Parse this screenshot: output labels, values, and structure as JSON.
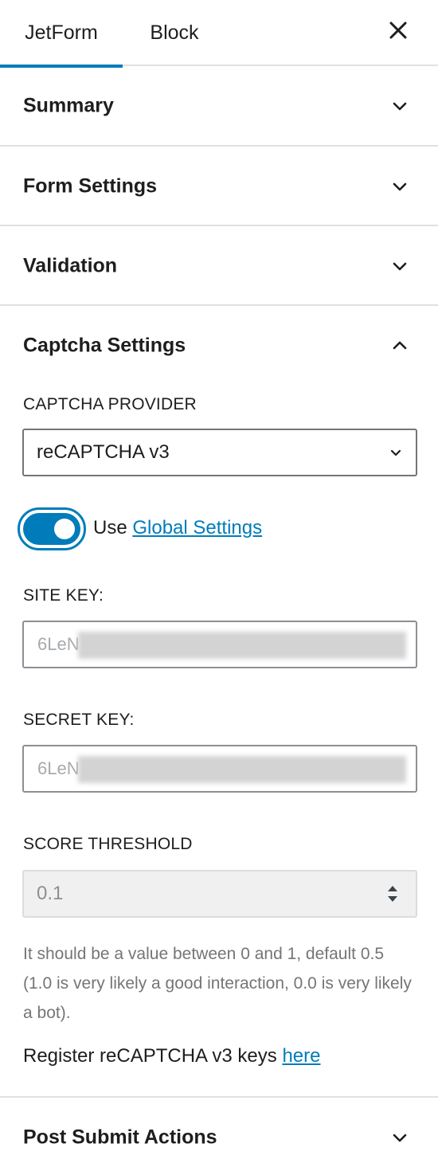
{
  "tabs": [
    {
      "label": "JetForm",
      "active": true
    },
    {
      "label": "Block",
      "active": false
    }
  ],
  "close_icon": "close-icon",
  "panels": {
    "summary": {
      "title": "Summary",
      "expanded": false
    },
    "form_settings": {
      "title": "Form Settings",
      "expanded": false
    },
    "validation": {
      "title": "Validation",
      "expanded": false
    },
    "captcha": {
      "title": "Captcha Settings",
      "expanded": true,
      "provider_label": "CAPTCHA PROVIDER",
      "provider_value": "reCAPTCHA v3",
      "use_global": true,
      "use_text": "Use",
      "use_link": "Global Settings",
      "site_key_label": "SITE KEY:",
      "site_key_value": "6LeN",
      "secret_key_label": "SECRET KEY:",
      "secret_key_value": "6LeN",
      "threshold_label": "SCORE THRESHOLD",
      "threshold_value": "0.1",
      "help_text": "It should be a value between 0 and 1, default 0.5 (1.0 is very likely a good interaction, 0.0 is very likely a bot).",
      "register_text": "Register reCAPTCHA v3 keys",
      "register_link": "here"
    },
    "post_submit": {
      "title": "Post Submit Actions",
      "expanded": false
    }
  },
  "colors": {
    "accent": "#007cba",
    "border": "#e0e0e0",
    "text": "#1e1e1e",
    "muted": "#757575"
  }
}
